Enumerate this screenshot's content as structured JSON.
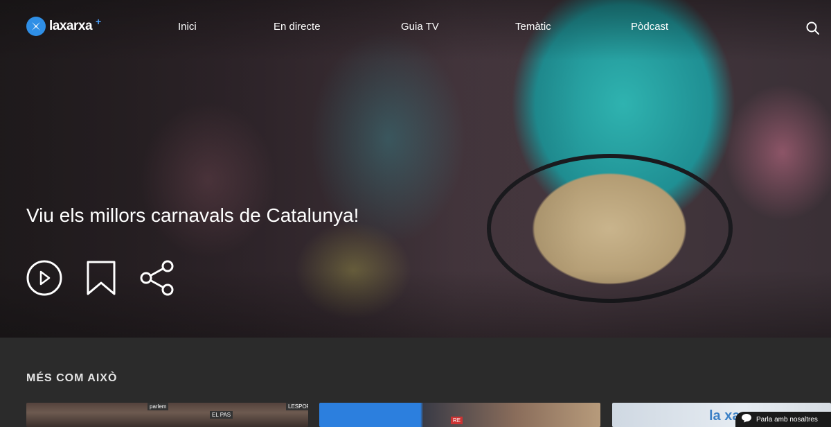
{
  "brand": {
    "name": "laxarxa",
    "plus": "+"
  },
  "nav": {
    "links": [
      "Inici",
      "En directe",
      "Guia TV",
      "Temàtic",
      "Pòdcast"
    ]
  },
  "hero": {
    "title": "Viu els millors carnavals de Catalunya!",
    "actions": [
      "play-icon",
      "bookmark-icon",
      "share-icon"
    ]
  },
  "section": {
    "title": "MÉS COM AIXÒ"
  },
  "cards": [
    {
      "tags": [
        "parlem",
        "EL PAS",
        "LESPORT"
      ]
    },
    {
      "tags": [
        "RE"
      ]
    },
    {
      "watermark": "la xarx"
    }
  ],
  "chat": {
    "label": "Parla amb nosaltres"
  }
}
